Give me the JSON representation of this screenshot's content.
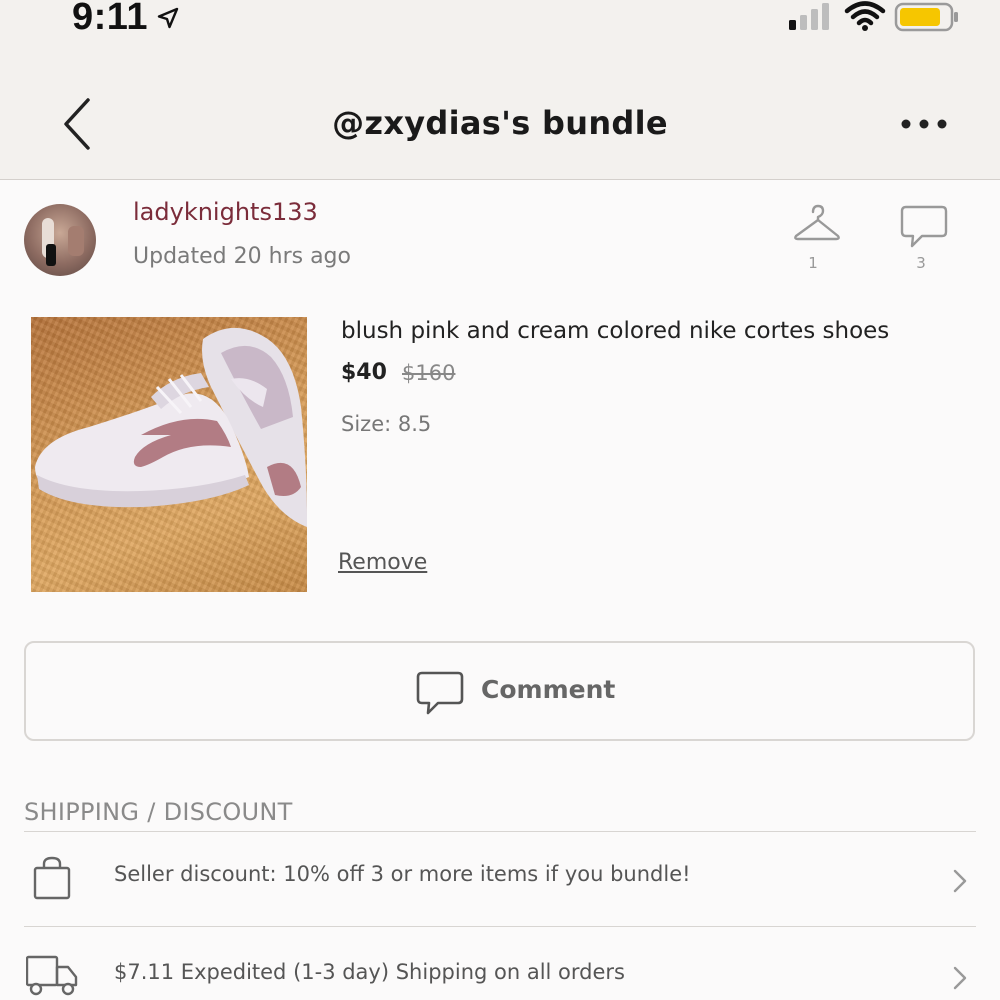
{
  "status_bar": {
    "time": "9:11"
  },
  "header": {
    "title": "@zxydias's bundle"
  },
  "seller": {
    "username": "ladyknights133",
    "updated": "Updated 20 hrs ago",
    "likes_count": "1",
    "comments_count": "3"
  },
  "product": {
    "title": "blush pink and cream colored nike cortes shoes",
    "price": "$40",
    "original_price": "$160",
    "size": "Size: 8.5",
    "remove_label": "Remove"
  },
  "comment_button": {
    "label": "Comment"
  },
  "shipping": {
    "heading": "SHIPPING / DISCOUNT",
    "rows": [
      {
        "icon": "shopping-bag-icon",
        "text": "Seller discount: 10% off 3 or more items if you bundle!"
      },
      {
        "icon": "delivery-truck-icon",
        "text": "$7.11 Expedited (1-3 day) Shipping on all orders"
      }
    ]
  },
  "colors": {
    "seller_name": "#7b2c3a",
    "header_bg": "#f3f1ee",
    "battery": "#f6c600"
  }
}
